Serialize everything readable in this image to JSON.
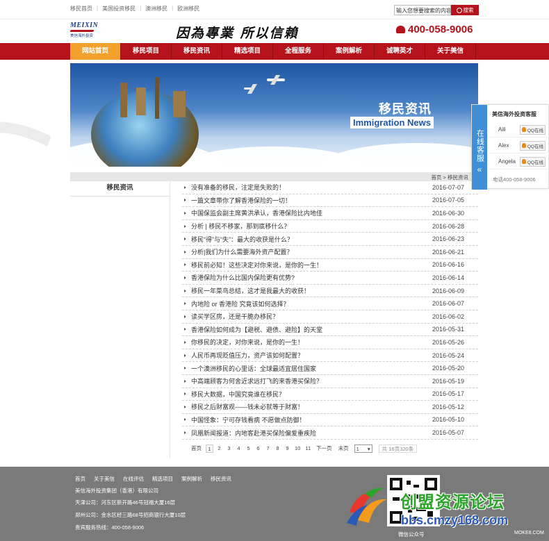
{
  "topbar": {
    "links": [
      "移民首页",
      "美国投资移民",
      "澳洲移民",
      "欧洲移民"
    ],
    "search_value": "输入您想要搜索的内容",
    "search_button": "搜索"
  },
  "header": {
    "logo_text": "MEIXIN",
    "logo_cn": "美信海外投资",
    "slogan": "因為專業 所以信賴",
    "phone": "400-058-9006"
  },
  "nav": {
    "items": [
      "网站首页",
      "移民项目",
      "移民资讯",
      "精选项目",
      "全程服务",
      "案例解析",
      "诚聘英才",
      "关于美信"
    ],
    "active_index": 0
  },
  "banner": {
    "title": "移民资讯",
    "subtitle": "Immigration News"
  },
  "breadcrumb": "首页 > 移民资讯",
  "sidebar": {
    "title": "移民资讯"
  },
  "news": [
    {
      "title": "没有准备的移民，注定是失败的！",
      "date": "2016-07-07"
    },
    {
      "title": "一篇文章带你了解香港保险的一切！",
      "date": "2016-07-05"
    },
    {
      "title": "中国保监会副主席黄洪承认，香港保险比内地佳",
      "date": "2016-06-30"
    },
    {
      "title": "分析 | 移民不移家，那到底移什么？",
      "date": "2016-06-28"
    },
    {
      "title": "移民“得”与“失”：最大的收获是什么？",
      "date": "2016-06-23"
    },
    {
      "title": "分析|我们为什么需要海外资产配置？",
      "date": "2016-06-21"
    },
    {
      "title": "移民前必知！这些决定对你来说，是你的一生！",
      "date": "2016-06-16"
    },
    {
      "title": "香港保险为什么比国内保险更有优势?",
      "date": "2016-06-14"
    },
    {
      "title": "移民一年菜鸟总结，这才是我最大的收获！",
      "date": "2016-06-09"
    },
    {
      "title": "内地险 or 香港险 究竟该如何选择？",
      "date": "2016-06-07"
    },
    {
      "title": "读买学区房，还是干脆办移民？",
      "date": "2016-06-02"
    },
    {
      "title": "香港保险如何成为【避税、避债、避险】的天堂",
      "date": "2016-05-31"
    },
    {
      "title": "你移民的决定，对你来说，是你的一生！",
      "date": "2016-05-26"
    },
    {
      "title": "人民币再现贬值压力，资产该如何配置？",
      "date": "2016-05-24"
    },
    {
      "title": "一个澳洲移民的心里话：全球最适宜居住国家",
      "date": "2016-05-20"
    },
    {
      "title": "中高端顾客为何舍近求远打飞的来香港买保险？",
      "date": "2016-05-19"
    },
    {
      "title": "移民大数据，中国究竟谁在移民？",
      "date": "2016-05-17"
    },
    {
      "title": "移民之后财富观——钱未必就等于财富！",
      "date": "2016-05-12"
    },
    {
      "title": "中国怪象：宁可存钱看病 不愿做点防御！",
      "date": "2016-05-10"
    },
    {
      "title": "凤凰新闻报道：内地客赴港买保险偏爱重疾险",
      "date": "2016-05-07"
    }
  ],
  "pager": {
    "first": "首页",
    "pages": [
      "1",
      "2",
      "3",
      "4",
      "5",
      "6",
      "7",
      "8",
      "9",
      "10",
      "11"
    ],
    "current": "1",
    "next": "下一页",
    "last": "末页",
    "select_value": "1",
    "summary": "共 16页320条"
  },
  "service": {
    "tab_label": "在线客服",
    "tab_arrow": "«",
    "title": "美信海外投资客服",
    "agents": [
      {
        "name": "Aili",
        "status": "QQ在线"
      },
      {
        "name": "Alex",
        "status": "QQ在线"
      },
      {
        "name": "Angela",
        "status": "QQ在线"
      }
    ],
    "phone": "电话400-058-9006"
  },
  "footer": {
    "links": [
      "首页",
      "关于美信",
      "在线评估",
      "精选项目",
      "案例解析",
      "移民资讯"
    ],
    "company": "美信海外投资集团（香港）有限公司",
    "tianjin": "天津公司：河东区新开路46号冠福大厦16层",
    "zhengzhou": "郑州公司：金水区经三路68号招商银行大厦10层",
    "hotline": "贵宾服务热线：400-058-9006",
    "qr_label": "微信公众号"
  },
  "watermark": {
    "cn": "创盟资源论坛",
    "url": "bbs.cmzy168.com",
    "moke": "MOKE8.COM"
  },
  "colors": {
    "brand_red": "#b5121b",
    "nav_active": "#f2a12c",
    "service_blue": "#3f8fd6",
    "footer_gray": "#7a7a7a"
  }
}
